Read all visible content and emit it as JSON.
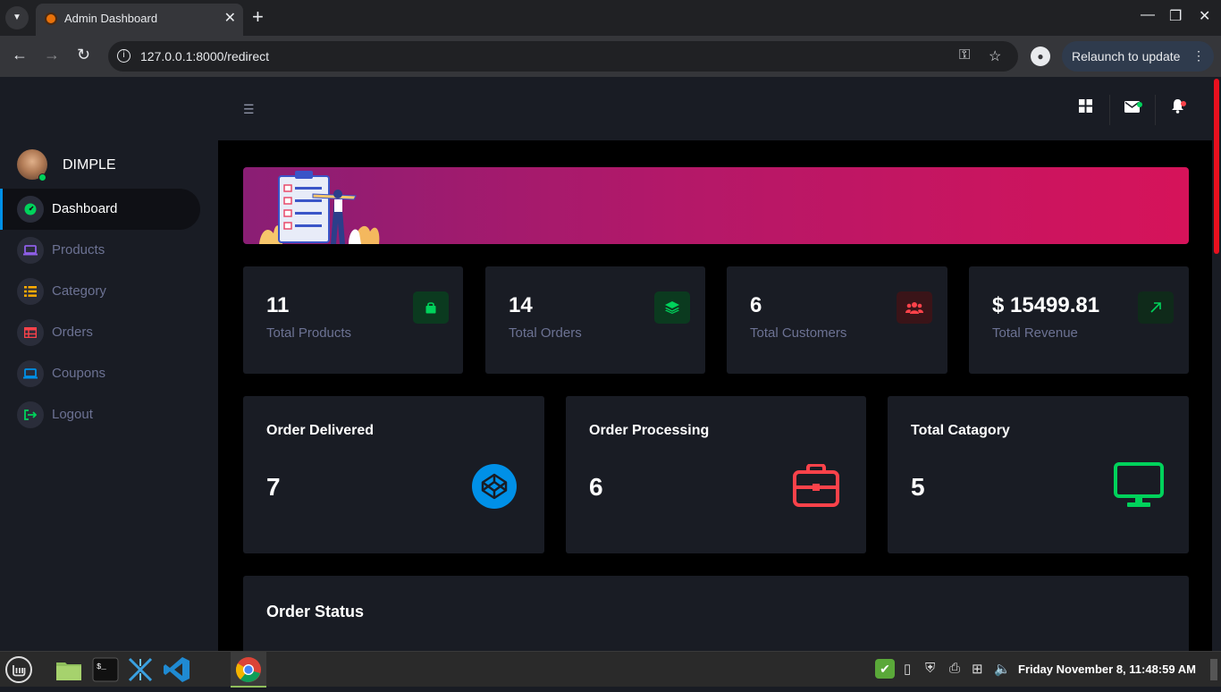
{
  "browser": {
    "tab_title": "Admin Dashboard",
    "url": "127.0.0.1:8000/redirect",
    "relaunch_label": "Relaunch to update"
  },
  "user": {
    "name": "DIMPLE"
  },
  "sidebar": {
    "items": [
      {
        "label": "Dashboard",
        "icon": "speedometer-icon",
        "color": "#00d25b"
      },
      {
        "label": "Products",
        "icon": "laptop-icon",
        "color": "#8f5fe8"
      },
      {
        "label": "Category",
        "icon": "list-icon",
        "color": "#ffab00"
      },
      {
        "label": "Orders",
        "icon": "table-icon",
        "color": "#fc424a"
      },
      {
        "label": "Coupons",
        "icon": "laptop-icon",
        "color": "#0090e7"
      },
      {
        "label": "Logout",
        "icon": "logout-icon",
        "color": "#00d25b"
      }
    ]
  },
  "stats": [
    {
      "value": "11",
      "label": "Total Products",
      "icon": "shopping-bag-icon",
      "color": "#00d25b"
    },
    {
      "value": "14",
      "label": "Total Orders",
      "icon": "layers-icon",
      "color": "#00d25b"
    },
    {
      "value": "6",
      "label": "Total Customers",
      "icon": "users-icon",
      "color": "#fc424a"
    },
    {
      "value": "$ 15499.81",
      "label": "Total Revenue",
      "icon": "arrow-up-right-icon",
      "color": "#00d25b"
    }
  ],
  "summary": [
    {
      "title": "Order Delivered",
      "value": "7",
      "icon": "codepen-icon",
      "color": "#0090e7"
    },
    {
      "title": "Order Processing",
      "value": "6",
      "icon": "briefcase-icon",
      "color": "#fc424a"
    },
    {
      "title": "Total Catagory",
      "value": "5",
      "icon": "monitor-icon",
      "color": "#00d25b"
    }
  ],
  "order_status": {
    "title": "Order Status"
  },
  "taskbar": {
    "clock": "Friday November  8, 11:48:59 AM"
  }
}
